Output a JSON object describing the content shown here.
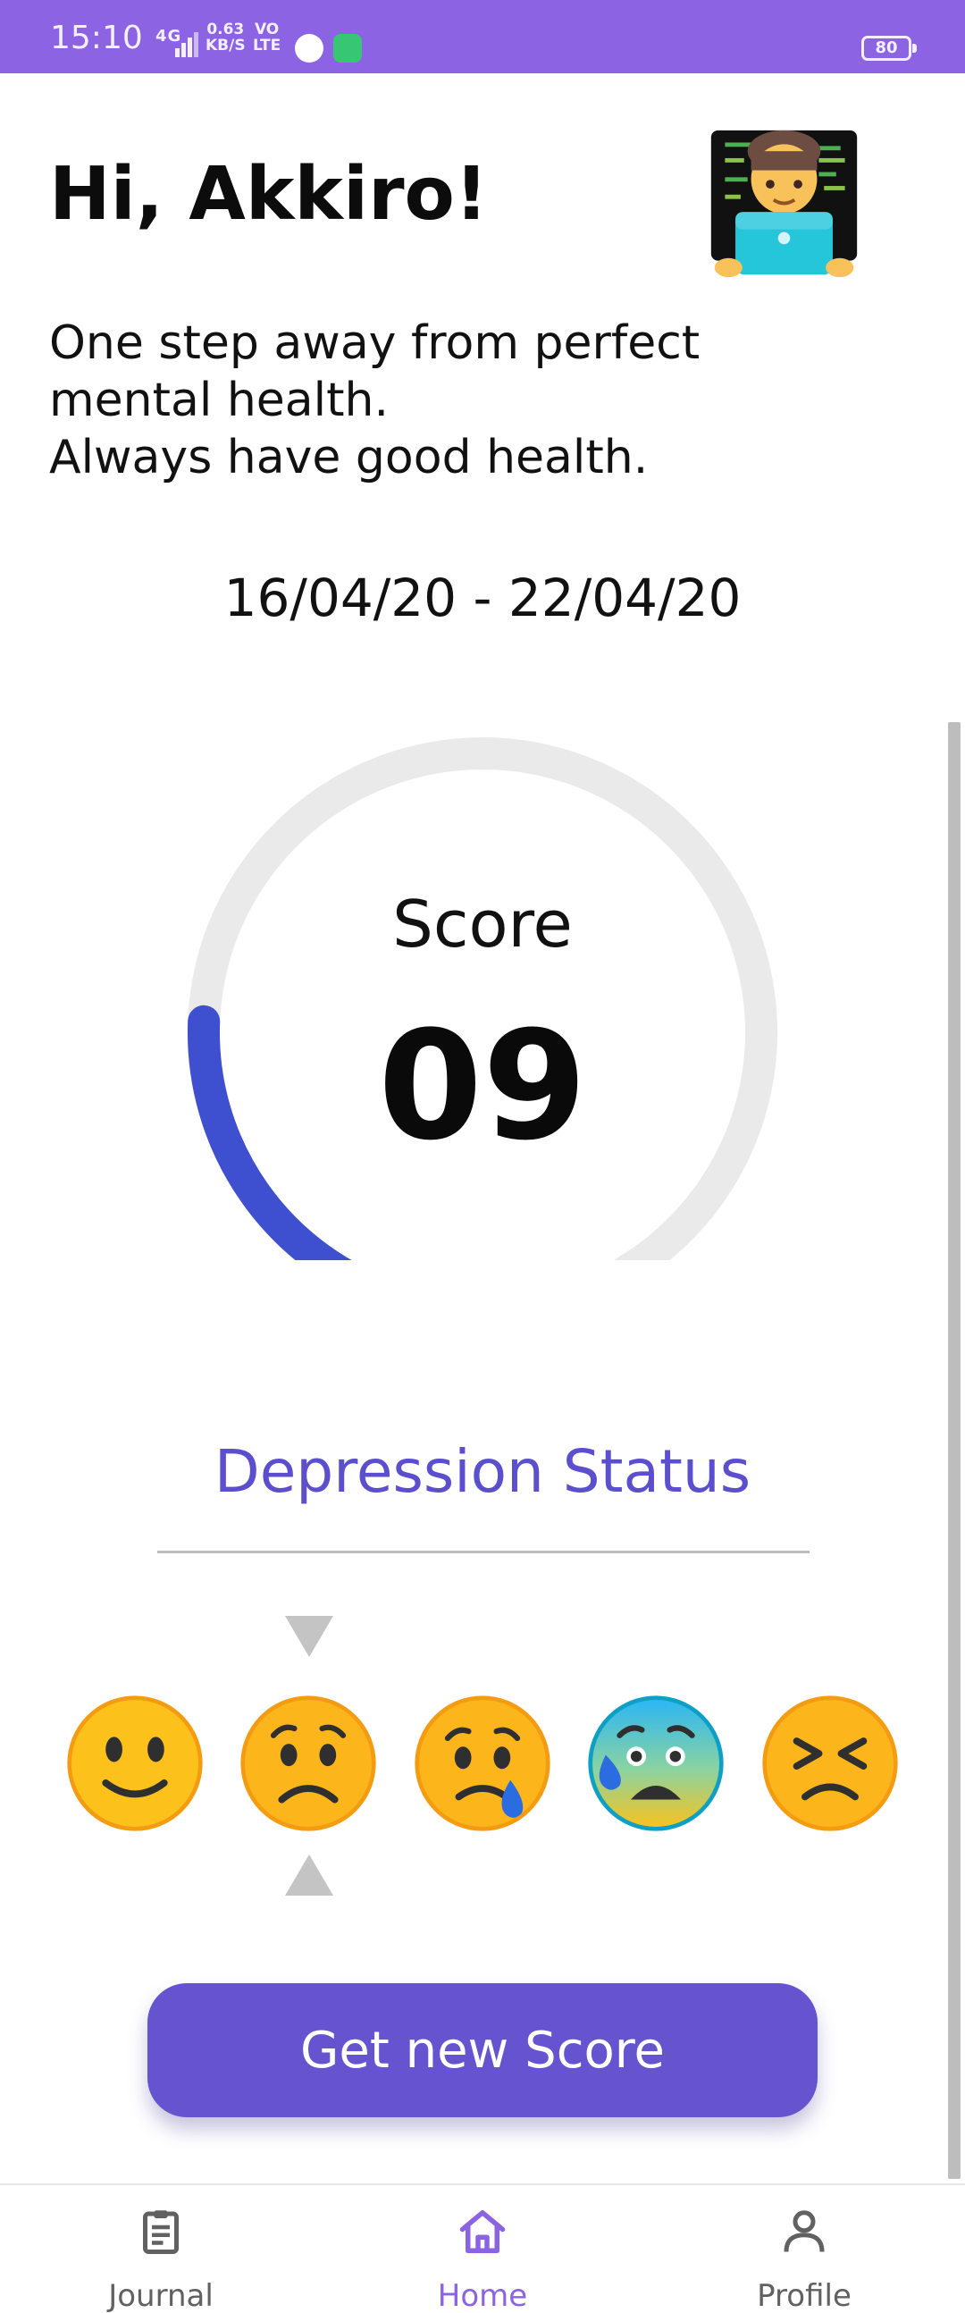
{
  "status_bar": {
    "time": "15:10",
    "network": "4G",
    "speed_value": "0.63",
    "speed_unit": "KB/S",
    "volte_top": "VO",
    "volte_bottom": "LTE",
    "battery": "80",
    "background_color": "#8b63e3"
  },
  "header": {
    "greeting": "Hi, Akkiro!",
    "avatar_icon": "technologist-emoji",
    "subtitle_line1": "One step away from perfect mental health.",
    "subtitle_line2": "Always have good health."
  },
  "date_range": "16/04/20 - 22/04/20",
  "score": {
    "label": "Score",
    "value": "09",
    "gauge_fraction": 0.23,
    "gauge_color": "#3e4fcf",
    "track_color": "#eaeaea"
  },
  "depression_status": {
    "heading": "Depression Status",
    "heading_color": "#5b4fce",
    "selected_index": 1,
    "levels": [
      {
        "icon": "slightly-smiling-face-icon"
      },
      {
        "icon": "worried-face-icon"
      },
      {
        "icon": "crying-face-icon"
      },
      {
        "icon": "anxious-face-with-sweat-icon"
      },
      {
        "icon": "confounded-face-icon"
      }
    ]
  },
  "cta": {
    "label": "Get new Score",
    "color": "#6553cf"
  },
  "bottom_nav": {
    "items": [
      {
        "label": "Journal",
        "icon": "clipboard-icon"
      },
      {
        "label": "Home",
        "icon": "home-icon",
        "active": true
      },
      {
        "label": "Profile",
        "icon": "person-icon"
      }
    ],
    "active_color": "#8b63e3"
  }
}
